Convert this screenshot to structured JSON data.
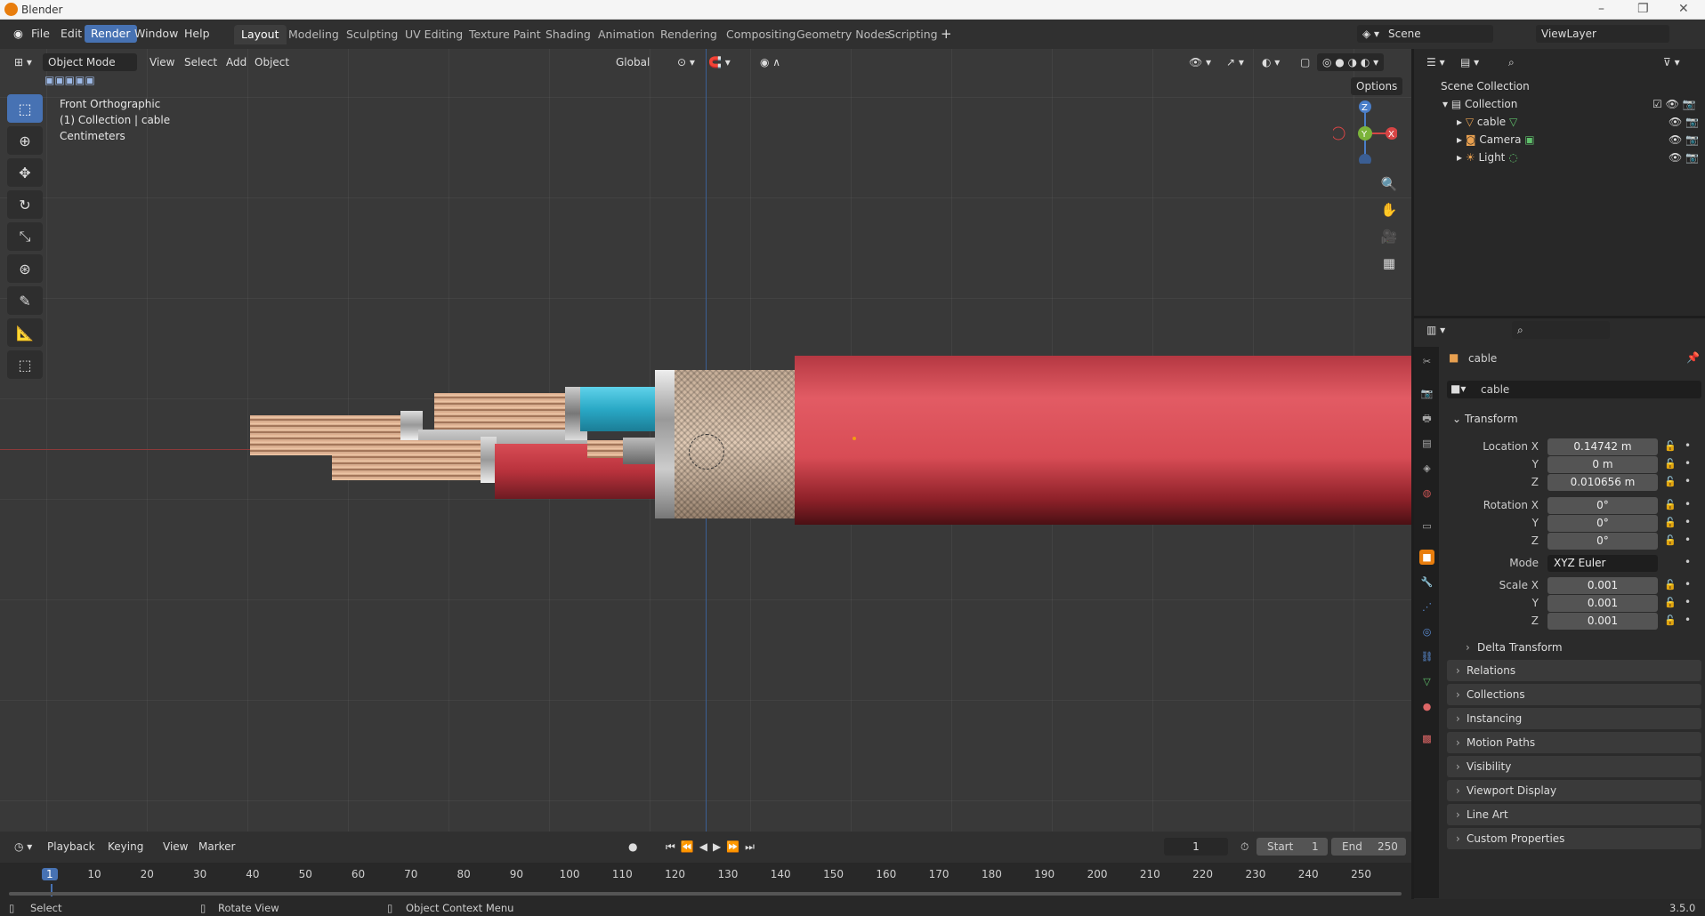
{
  "window": {
    "title": "Blender"
  },
  "menubar": {
    "file": "File",
    "edit": "Edit",
    "render": "Render",
    "window": "Window",
    "help": "Help"
  },
  "workspaces": [
    "Layout",
    "Modeling",
    "Sculpting",
    "UV Editing",
    "Texture Paint",
    "Shading",
    "Animation",
    "Rendering",
    "Compositing",
    "Geometry Nodes",
    "Scripting"
  ],
  "scene": {
    "name": "Scene",
    "view_layer": "ViewLayer"
  },
  "viewport": {
    "mode": "Object Mode",
    "menus": [
      "View",
      "Select",
      "Add",
      "Object"
    ],
    "orientation": "Global",
    "options": "Options",
    "overlay_lines": [
      "Front Orthographic",
      "(1) Collection | cable",
      "Centimeters"
    ]
  },
  "outliner": {
    "root": "Scene Collection",
    "collection": "Collection",
    "objects": [
      "cable",
      "Camera",
      "Light"
    ]
  },
  "properties": {
    "object_name": "cable",
    "data_name": "cable",
    "transform_label": "Transform",
    "location": {
      "label_x": "Location X",
      "x": "0.14742 m",
      "y": "0 m",
      "z": "0.010656 m"
    },
    "rotation": {
      "label_x": "Rotation X",
      "x": "0°",
      "y": "0°",
      "z": "0°"
    },
    "mode": {
      "label": "Mode",
      "value": "XYZ Euler"
    },
    "scale": {
      "label_x": "Scale X",
      "x": "0.001",
      "y": "0.001",
      "z": "0.001"
    },
    "axis": {
      "y": "Y",
      "z": "Z"
    },
    "delta": "Delta Transform",
    "panels": [
      "Relations",
      "Collections",
      "Instancing",
      "Motion Paths",
      "Visibility",
      "Viewport Display",
      "Line Art",
      "Custom Properties"
    ]
  },
  "timeline": {
    "menus": [
      "Playback",
      "Keying",
      "View",
      "Marker"
    ],
    "current_frame": "1",
    "start_label": "Start",
    "start": "1",
    "end_label": "End",
    "end": "250",
    "ticks": [
      "1",
      "10",
      "20",
      "30",
      "40",
      "50",
      "60",
      "70",
      "80",
      "90",
      "100",
      "110",
      "120",
      "130",
      "140",
      "150",
      "160",
      "170",
      "180",
      "190",
      "200",
      "210",
      "220",
      "230",
      "240",
      "250"
    ]
  },
  "status": {
    "select": "Select",
    "rotate": "Rotate View",
    "context": "Object Context Menu",
    "version": "3.5.0"
  },
  "colors": {
    "accent": "#4772b3",
    "cable_jacket": "#d9474f",
    "cyan_wire": "#35b7d3"
  }
}
